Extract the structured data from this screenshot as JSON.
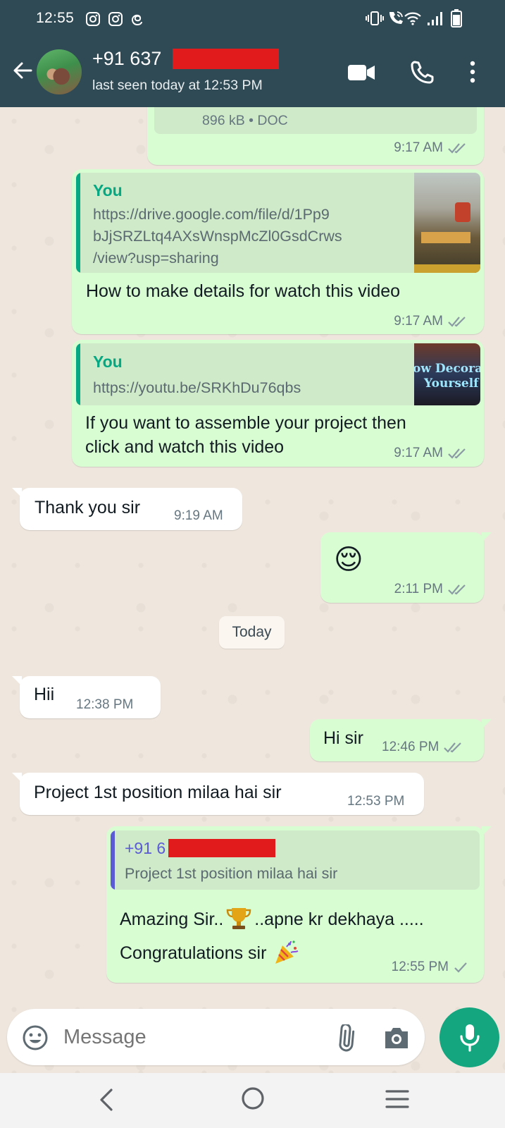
{
  "status_bar": {
    "time": "12:55",
    "left_icons": [
      "instagram-icon",
      "instagram-icon",
      "threads-icon"
    ],
    "right_icons": [
      "vibrate-icon",
      "wifi-calling-icon",
      "wifi-icon",
      "signal-icon",
      "battery-icon"
    ]
  },
  "header": {
    "contact_name": "+91 637",
    "last_seen": "last seen today at 12:53 PM",
    "icons": [
      "back-arrow-icon",
      "video-call-icon",
      "voice-call-icon",
      "more-options-icon"
    ]
  },
  "messages": {
    "doc_size": "896 kB • DOC",
    "doc_time": "9:17 AM",
    "link1": {
      "author": "You",
      "url_line1": "https://drive.google.com/file/d/1Pp9",
      "url_line2": "bJjSRZLtq4AXsWnspMcZl0GsdCrws",
      "url_line3": "/view?usp=sharing",
      "text": "How to make details for watch this video",
      "time": "9:17 AM"
    },
    "link2": {
      "author": "You",
      "url": "https://youtu.be/SRKhDu76qbs",
      "thumb_text_line1": "ow Decora",
      "thumb_text_line2": "Yourself",
      "text_line1": "If you want to assemble your project then",
      "text_line2": "click and watch this video",
      "time": "9:17 AM"
    },
    "thanks": {
      "text": "Thank you sir",
      "time": "9:19 AM"
    },
    "emoji": {
      "text": "😌",
      "time": "2:11 PM"
    },
    "date_chip": "Today",
    "hii": {
      "text": "Hii",
      "time": "12:38 PM"
    },
    "hi_sir": {
      "text": "Hi sir",
      "time": "12:46 PM"
    },
    "project": {
      "text": "Project 1st position milaa hai sir",
      "time": "12:53 PM"
    },
    "reply": {
      "quote_author": "+91 6",
      "quote_text": "Project 1st position milaa hai sir",
      "line1_part1": "Amazing Sir..",
      "line1_part2": "..apne kr dekhaya .....",
      "line2": "Congratulations sir",
      "time": "12:55 PM"
    }
  },
  "input": {
    "placeholder": "Message",
    "icons": [
      "emoji-icon",
      "attach-icon",
      "camera-icon",
      "mic-icon"
    ]
  },
  "colors": {
    "header_bg": "#2f4a55",
    "outgoing_bubble": "#d9fdd3",
    "incoming_bubble": "#ffffff",
    "accent_green": "#06a884",
    "read_ticks": "#8a9ba3",
    "mic_button": "#14a67e",
    "redaction": "#e11b1b"
  }
}
